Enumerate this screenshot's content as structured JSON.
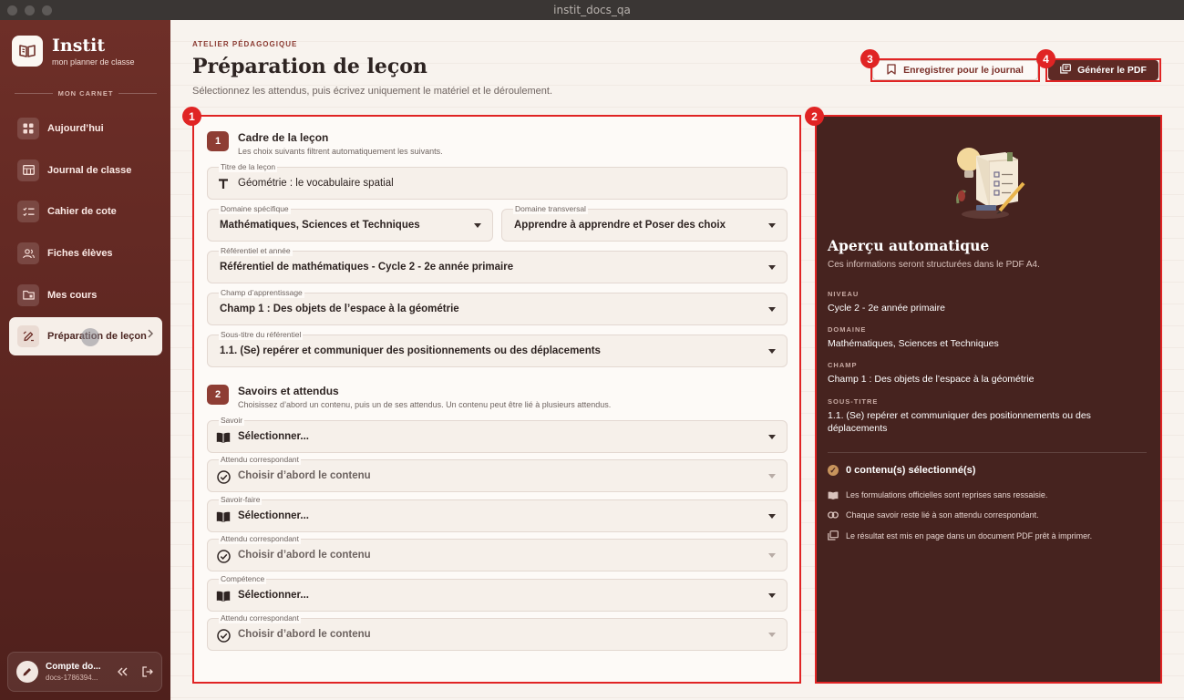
{
  "window": {
    "title": "instit_docs_qa"
  },
  "brand": {
    "name": "Instit",
    "subtitle": "mon planner de classe"
  },
  "sidebar": {
    "section_label": "MON CARNET",
    "items": [
      {
        "label": "Aujourd’hui",
        "icon": "grid-icon"
      },
      {
        "label": "Journal de classe",
        "icon": "table-icon"
      },
      {
        "label": "Cahier de cote",
        "icon": "checklist-icon"
      },
      {
        "label": "Fiches élèves",
        "icon": "users-icon"
      },
      {
        "label": "Mes cours",
        "icon": "folder-icon"
      },
      {
        "label": "Préparation de leçon",
        "icon": "edit-icon",
        "active": true
      }
    ],
    "account": {
      "name": "Compte do...",
      "sub": "docs-1786394..."
    }
  },
  "header": {
    "kicker": "ATELIER PÉDAGOGIQUE",
    "title": "Préparation de leçon",
    "subtitle": "Sélectionnez les attendus, puis écrivez uniquement le matériel et le déroulement."
  },
  "actions": {
    "journal_label": "Enregistrer pour le journal",
    "pdf_label": "Générer le PDF"
  },
  "annotations": [
    "1",
    "2",
    "3",
    "4"
  ],
  "step1": {
    "num": "1",
    "title": "Cadre de la leçon",
    "desc": "Les choix suivants filtrent automatiquement les suivants.",
    "titre": {
      "label": "Titre de la leçon",
      "value": "Géométrie : le vocabulaire spatial"
    },
    "domaine_specifique": {
      "label": "Domaine spécifique",
      "value": "Mathématiques, Sciences et Techniques"
    },
    "domaine_transversal": {
      "label": "Domaine transversal",
      "value": "Apprendre à apprendre et Poser des choix"
    },
    "referentiel": {
      "label": "Référentiel et année",
      "value": "Référentiel de mathématiques - Cycle 2 - 2e année primaire"
    },
    "champ": {
      "label": "Champ d’apprentissage",
      "value": "Champ 1 : Des objets de l’espace à la géométrie"
    },
    "sous_titre": {
      "label": "Sous-titre du référentiel",
      "value": "1.1. (Se) repérer et communiquer des positionnements ou des déplacements"
    }
  },
  "step2": {
    "num": "2",
    "title": "Savoirs et attendus",
    "desc": "Choisissez d’abord un contenu, puis un de ses attendus. Un contenu peut être lié à plusieurs attendus.",
    "savoir": {
      "label": "Savoir",
      "value": "Sélectionner..."
    },
    "attendu1": {
      "label": "Attendu correspondant",
      "value": "Choisir d’abord le contenu"
    },
    "savoir_faire": {
      "label": "Savoir-faire",
      "value": "Sélectionner..."
    },
    "attendu2": {
      "label": "Attendu correspondant",
      "value": "Choisir d’abord le contenu"
    },
    "competence": {
      "label": "Compétence",
      "value": "Sélectionner..."
    },
    "attendu3": {
      "label": "Attendu correspondant",
      "value": "Choisir d’abord le contenu"
    }
  },
  "preview": {
    "title": "Aperçu automatique",
    "subtitle": "Ces informations seront structurées dans le PDF A4.",
    "niveau": {
      "key": "NIVEAU",
      "value": "Cycle 2 - 2e année primaire"
    },
    "domaine": {
      "key": "DOMAINE",
      "value": "Mathématiques, Sciences et Techniques"
    },
    "champ": {
      "key": "CHAMP",
      "value": "Champ 1 : Des objets de l’espace à la géométrie"
    },
    "sous_titre": {
      "key": "SOUS-TITRE",
      "value": "1.1. (Se) repérer et communiquer des positionnements ou des déplacements"
    },
    "count": "0 contenu(s) sélectionné(s)",
    "notes": [
      "Les formulations officielles sont reprises sans ressaisie.",
      "Chaque savoir reste lié à son attendu correspondant.",
      "Le résultat est mis en page dans un document PDF prêt à imprimer."
    ]
  },
  "colors": {
    "accent": "#8e3d34",
    "sidebar": "#6e2f28",
    "preview": "#46231f",
    "highlight": "#e02424"
  }
}
